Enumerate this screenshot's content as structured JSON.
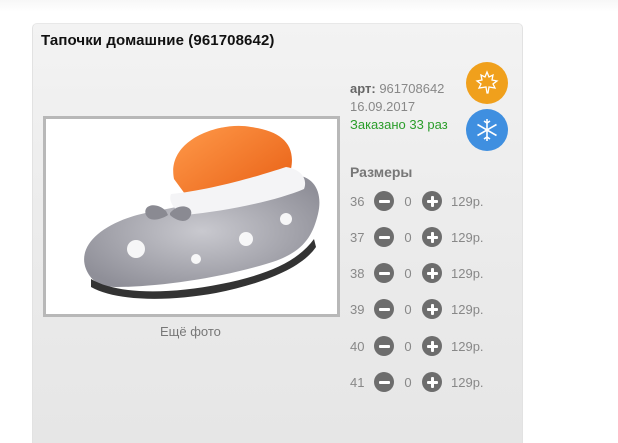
{
  "product": {
    "title": "Тапочки домашние (961708642)",
    "art_label": "арт:",
    "art_value": "961708642",
    "date": "16.09.2017",
    "ordered": "Заказано 33 раз",
    "more_photo": "Ещё фото"
  },
  "seasons": [
    {
      "name": "autumn",
      "icon": "maple-leaf-icon",
      "color": "#f0a01c"
    },
    {
      "name": "winter",
      "icon": "snowflake-icon",
      "color": "#3f8fe0"
    }
  ],
  "sizes": {
    "title": "Размеры",
    "rows": [
      {
        "size": "36",
        "qty": "0",
        "price": "129р."
      },
      {
        "size": "37",
        "qty": "0",
        "price": "129р."
      },
      {
        "size": "38",
        "qty": "0",
        "price": "129р."
      },
      {
        "size": "39",
        "qty": "0",
        "price": "129р."
      },
      {
        "size": "40",
        "qty": "0",
        "price": "129р."
      },
      {
        "size": "41",
        "qty": "0",
        "price": "129р."
      }
    ]
  }
}
